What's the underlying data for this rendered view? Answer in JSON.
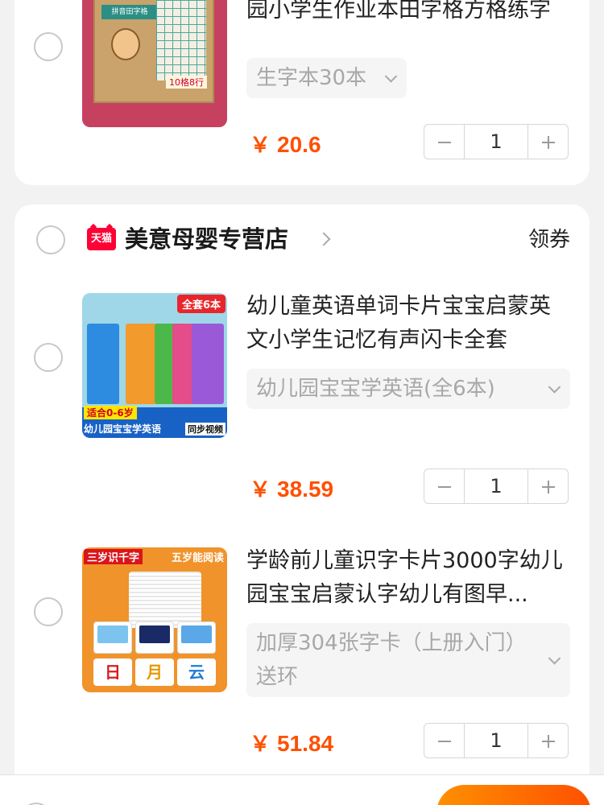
{
  "products_top": {
    "title": "低年级上学期低年级上学年幼儿园小学生作业本田字格方格练字",
    "sku": "生字本30本",
    "price_symbol": "￥",
    "price": "20.6",
    "quantity": "1",
    "thumb_text": {
      "book_title": "拼音田字格",
      "tag": "10格8行"
    }
  },
  "store": {
    "name": "美意母婴专营店",
    "badge": "天猫",
    "coupon": "领券",
    "items": [
      {
        "title": "幼儿童英语单词卡片宝宝启蒙英文小学生记忆有声闪卡全套",
        "sku": "幼儿园宝宝学英语(全6本)",
        "price_symbol": "￥",
        "price": "38.59",
        "quantity": "1",
        "thumb_text": {
          "banner": "全套6本",
          "line1": "适合0-6岁",
          "line2": "幼儿园宝宝学英语",
          "line3": "同步视频"
        }
      },
      {
        "title": "学龄前儿童识字卡片3000字幼儿园宝宝启蒙认字幼儿有图早...",
        "sku": "加厚304张字卡（上册入门） 送环",
        "price_symbol": "￥",
        "price": "51.84",
        "quantity": "1",
        "thumb_text": {
          "label1": "三岁识千字",
          "label2": "五岁能阅读",
          "char1": "日",
          "char2": "月",
          "char3": "云"
        }
      }
    ]
  },
  "colors": {
    "price": "#ff5000",
    "tmall_red": "#ff0036",
    "checkout_gradient": [
      "#ff9000",
      "#ff5000"
    ]
  }
}
